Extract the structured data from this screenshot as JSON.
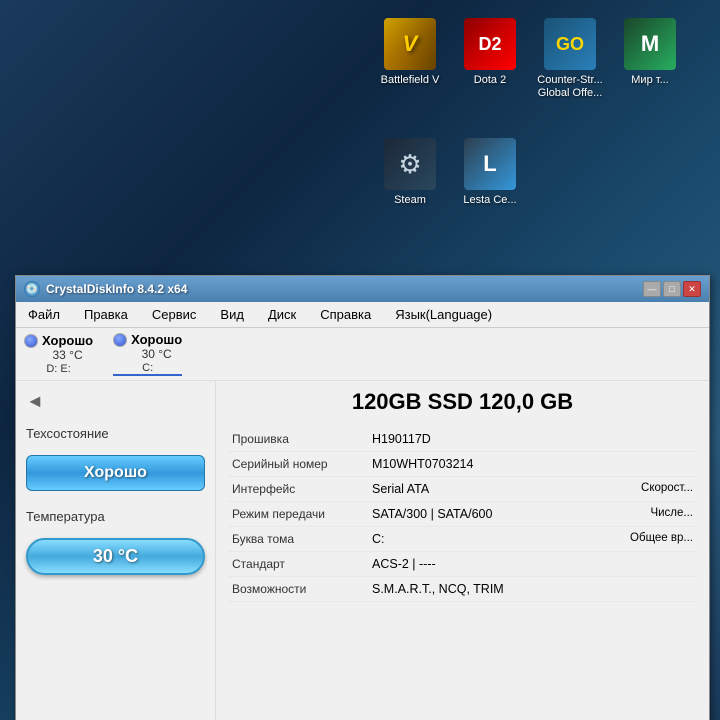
{
  "desktop": {
    "icons": [
      {
        "id": "battlefield-v",
        "label": "Battlefield V",
        "type": "bf"
      },
      {
        "id": "dota-2",
        "label": "Dota 2",
        "type": "dota"
      },
      {
        "id": "counter-strike",
        "label": "Counter-Str... Global Offe...",
        "type": "csgo"
      },
      {
        "id": "mir",
        "label": "Мир т...",
        "type": "mir"
      },
      {
        "id": "steam",
        "label": "Steam",
        "type": "steam"
      },
      {
        "id": "lesta",
        "label": "Lesta Ce...",
        "type": "lesta"
      }
    ]
  },
  "window": {
    "title": "CrystalDiskInfo 8.4.2 x64",
    "menu": {
      "items": [
        "Файл",
        "Правка",
        "Сервис",
        "Вид",
        "Диск",
        "Справка",
        "Язык(Language)"
      ]
    },
    "drives": [
      {
        "status": "Хорошо",
        "temp": "33 °C",
        "letters": "D: E:",
        "dot_color": "blue"
      },
      {
        "status": "Хорошо",
        "temp": "30 °C",
        "letters": "C:",
        "dot_color": "blue",
        "active": true
      }
    ],
    "disk_title": "120GB SSD  120,0 GB",
    "left_panel": {
      "tech_state_label": "Техсостояние",
      "status": "Хорошо",
      "temp_label": "Температура",
      "temp": "30 °C"
    },
    "info_rows": [
      {
        "label": "Прошивка",
        "value": "H190117D",
        "right": ""
      },
      {
        "label": "Серийный номер",
        "value": "M10WHT0703214",
        "right": ""
      },
      {
        "label": "Интерфейс",
        "value": "Serial ATA",
        "right": "Скорост..."
      },
      {
        "label": "Режим передачи",
        "value": "SATA/300 | SATA/600",
        "right": "Числе..."
      },
      {
        "label": "Буква тома",
        "value": "C:",
        "right": "Общее вр..."
      },
      {
        "label": "Стандарт",
        "value": "ACS-2 | ----",
        "right": ""
      },
      {
        "label": "Возможности",
        "value": "S.M.A.R.T., NCQ, TRIM",
        "right": ""
      }
    ]
  }
}
